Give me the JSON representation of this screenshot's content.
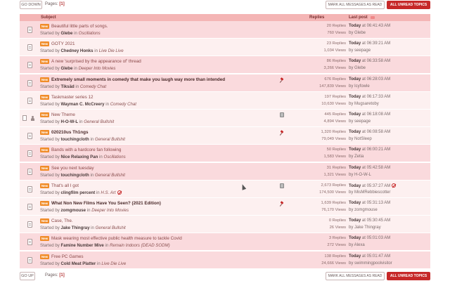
{
  "top_bar": {
    "go_label": "GO DOWN",
    "pages_label": "Pages:",
    "page_num": "[1]",
    "mark_label": "MARK ALL MESSAGES AS READ",
    "unread_label": "ALL UNREAD TOPICS"
  },
  "bottom_bar": {
    "go_label": "GO UP",
    "pages_label": "Pages:",
    "page_num": "[1]",
    "mark_label": "MARK ALL MESSAGES AS READ",
    "unread_label": "ALL UNREAD TOPICS"
  },
  "header": {
    "subject": "Subject",
    "replies": "Replies",
    "last_post": "Last post"
  },
  "colors": {
    "accent": "#c62828",
    "new_badge": "#f08c28",
    "header_bg": "#f4b5b5",
    "row_pink": "#fadadd",
    "row_light": "#fdf0f0"
  },
  "topics": [
    {
      "new": "New",
      "title": "Beautiful little parts of songs.",
      "started_prefix": "Started by",
      "author": "Glebe",
      "in": "in",
      "board": "Oscillations",
      "replies": "20 Replies",
      "views": "760 Views",
      "date": "Today",
      "time": "at 06:41:43 AM",
      "by": "by Glebe"
    },
    {
      "new": "New",
      "title": "GOTY 2021",
      "started_prefix": "Started by",
      "author": "Chedney Honks",
      "in": "in",
      "board": "Live Die Live",
      "replies": "23 Replies",
      "views": "1,034 Views",
      "date": "Today",
      "time": "at 06:39:21 AM",
      "by": "by seepage"
    },
    {
      "new": "New",
      "title": "A new 'surprised by the appearance of' thread",
      "started_prefix": "Started by",
      "author": "Glebe",
      "in": "in",
      "board": "Deeper Into Movies",
      "replies": "86 Replies",
      "views": "3,266 Views",
      "date": "Today",
      "time": "at 06:33:58 AM",
      "by": "by Glebe"
    },
    {
      "new": "New",
      "title": "Extremely small moments in comedy that make you laugh way more than intended",
      "started_prefix": "Started by",
      "author": "Tiksäd",
      "in": "in",
      "board": "Comedy Chat",
      "replies": "676 Replies",
      "views": "147,839 Views",
      "date": "Today",
      "time": "at 06:28:03 AM",
      "by": "by Icyfowle"
    },
    {
      "new": "New",
      "title": "Taskmaster series 12",
      "started_prefix": "Started by",
      "author": "Wayman C. McCreery",
      "in": "in",
      "board": "Comedy Chat",
      "replies": "197 Replies",
      "views": "10,630 Views",
      "date": "Today",
      "time": "at 06:17:33 AM",
      "by": "by Mugsaretoby"
    },
    {
      "new": "New",
      "title": "New Theme",
      "started_prefix": "Started by",
      "author": "H-O-W-L",
      "in": "in",
      "board": "General Bullshit",
      "replies": "445 Replies",
      "views": "4,894 Views",
      "date": "Today",
      "time": "at 06:18:08 AM",
      "by": "by seepage"
    },
    {
      "new": "New",
      "title": "020210us Th1ngs",
      "started_prefix": "Started by",
      "author": "touchingcloth",
      "in": "in",
      "board": "General Bullshit",
      "replies": "1,320 Replies",
      "views": "79,049 Views",
      "date": "Today",
      "time": "at 06:08:58 AM",
      "by": "by NotSleep"
    },
    {
      "new": "New",
      "title": "Bands with a hardcore fan following",
      "started_prefix": "Started by",
      "author": "Nice Relaxing Pan",
      "in": "in",
      "board": "Oscillations",
      "replies": "50 Replies",
      "views": "1,583 Views",
      "date": "Today",
      "time": "at 06:00:21 AM",
      "by": "by Zetia"
    },
    {
      "new": "New",
      "title": "See you next tuesday",
      "started_prefix": "Started by",
      "author": "touchingcloth",
      "in": "in",
      "board": "General Bullshit",
      "replies": "31 Replies",
      "views": "1,321 Views",
      "date": "Today",
      "time": "at 05:42:58 AM",
      "by": "by H-O-W-L"
    },
    {
      "new": "New",
      "title": "That's all I got",
      "started_prefix": "Started by",
      "author": "clingfilm percent",
      "in": "in",
      "board": "H.S. Art",
      "replies": "2,673 Replies",
      "views": "174,500 Views",
      "date": "Today",
      "time": "at 05:37:27 AM",
      "by": "by MisMRebbiescotter"
    },
    {
      "new": "New",
      "title": "What Non New Films Have You Seen? (2021 Edition)",
      "started_prefix": "Started by",
      "author": "zomgmouse",
      "in": "in",
      "board": "Deeper Into Movies",
      "replies": "1,639 Replies",
      "views": "76,170 Views",
      "date": "Today",
      "time": "at 05:31:13 AM",
      "by": "by zomgmouse"
    },
    {
      "new": "New",
      "title": "Case, The.",
      "started_prefix": "Started by",
      "author": "Jake Thingray",
      "in": "in",
      "board": "General Bullshit",
      "replies": "0 Replies",
      "views": "26 Views",
      "date": "Today",
      "time": "at 05:30:45 AM",
      "by": "by Jake Thingray"
    },
    {
      "new": "New",
      "title": "Mask wearing most effective public health measure to tackle Covid",
      "started_prefix": "Started by",
      "author": "Famine Number Mive",
      "in": "in",
      "board": "Remain Indoors (DEAD SODM)",
      "replies": "3 Replies",
      "views": "272 Views",
      "date": "Today",
      "time": "at 05:01:03 AM",
      "by": "by Alexa"
    },
    {
      "new": "New",
      "title": "Free PC Games",
      "started_prefix": "Started by",
      "author": "Cold Meat Platter",
      "in": "in",
      "board": "Live Die Live",
      "replies": "138 Replies",
      "views": "24,666 Views",
      "date": "Today",
      "time": "at 05:01:47 AM",
      "by": "by swimmingpoolvisitor"
    }
  ]
}
